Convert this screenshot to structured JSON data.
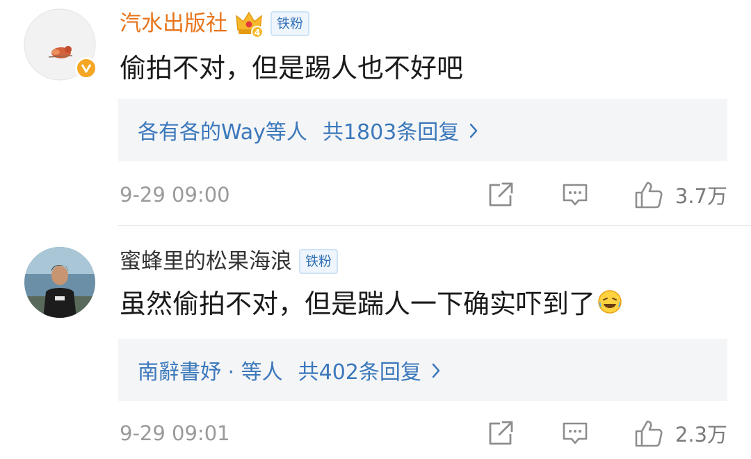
{
  "comments": [
    {
      "username": "汽水出版社",
      "username_color": "#e8741a",
      "badge": "铁粉",
      "text": "偷拍不对，但是踢人也不好吧",
      "reply_names": "各有各的Way等人",
      "reply_count": "共1803条回复",
      "timestamp": "9-29 09:00",
      "likes": "3.7万",
      "crown_level": "4"
    },
    {
      "username": "蜜蜂里的松果海浪",
      "username_color": "#333333",
      "badge": "铁粉",
      "text": "虽然偷拍不对，但是踹人一下确实吓到了",
      "reply_names": "南辭書妤 · 等人",
      "reply_count": "共402条回复",
      "timestamp": "9-29 09:01",
      "likes": "2.3万"
    }
  ],
  "icons": {
    "share": "share-icon",
    "comment": "comment-icon",
    "like": "thumbs-up-icon",
    "verified": "verified-v-icon",
    "crown": "crown-icon",
    "chevron": "chevron-right-icon",
    "emoji": "laughing-tears-emoji"
  },
  "colors": {
    "link_blue": "#3b78bb",
    "meta_gray": "#9a9a9a",
    "reply_bg": "#f4f5f7",
    "verified_gold": "#f5a623"
  }
}
